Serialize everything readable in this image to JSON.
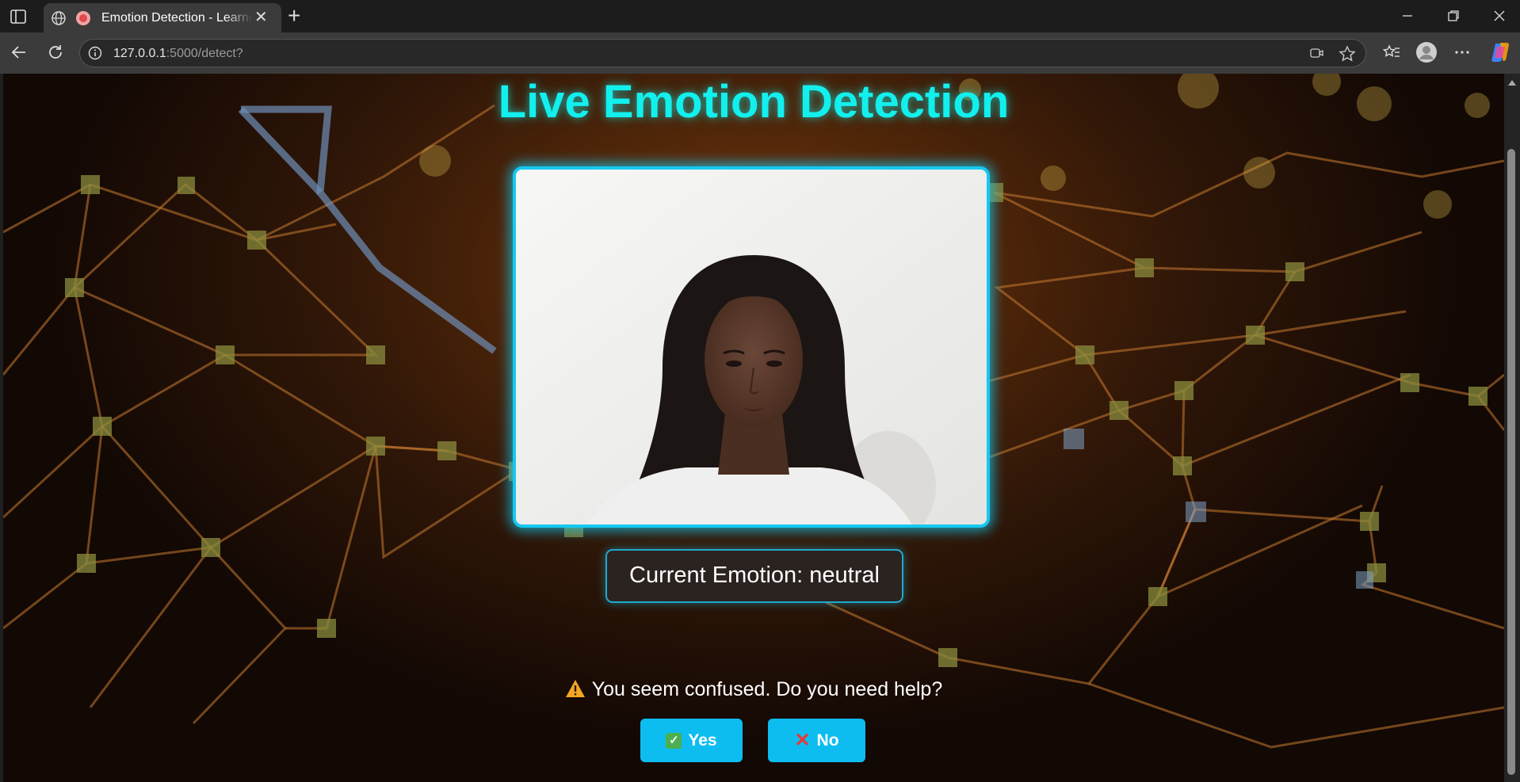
{
  "browser": {
    "tab_title": "Emotion Detection - Learnora",
    "url_host": "127.0.0.1",
    "url_path": ":5000/detect?",
    "window_controls": [
      "minimize-icon",
      "restore-icon",
      "close-icon"
    ],
    "new_tab_label": "+",
    "tab_close_label": "✕"
  },
  "page": {
    "title": "Live Emotion Detection",
    "camera_alt": "Live webcam feed",
    "emotion_prefix": "Current Emotion:",
    "emotion_value": "neutral",
    "emotion_text": "Current Emotion: neutral",
    "prompt": "You seem confused. Do you need help?",
    "yes_label": "Yes",
    "no_label": "No",
    "colors": {
      "accent": "#12f0ee",
      "frame_border": "#16c8f0",
      "button_bg": "#0dbdf0",
      "background": "#3a1a06"
    }
  }
}
